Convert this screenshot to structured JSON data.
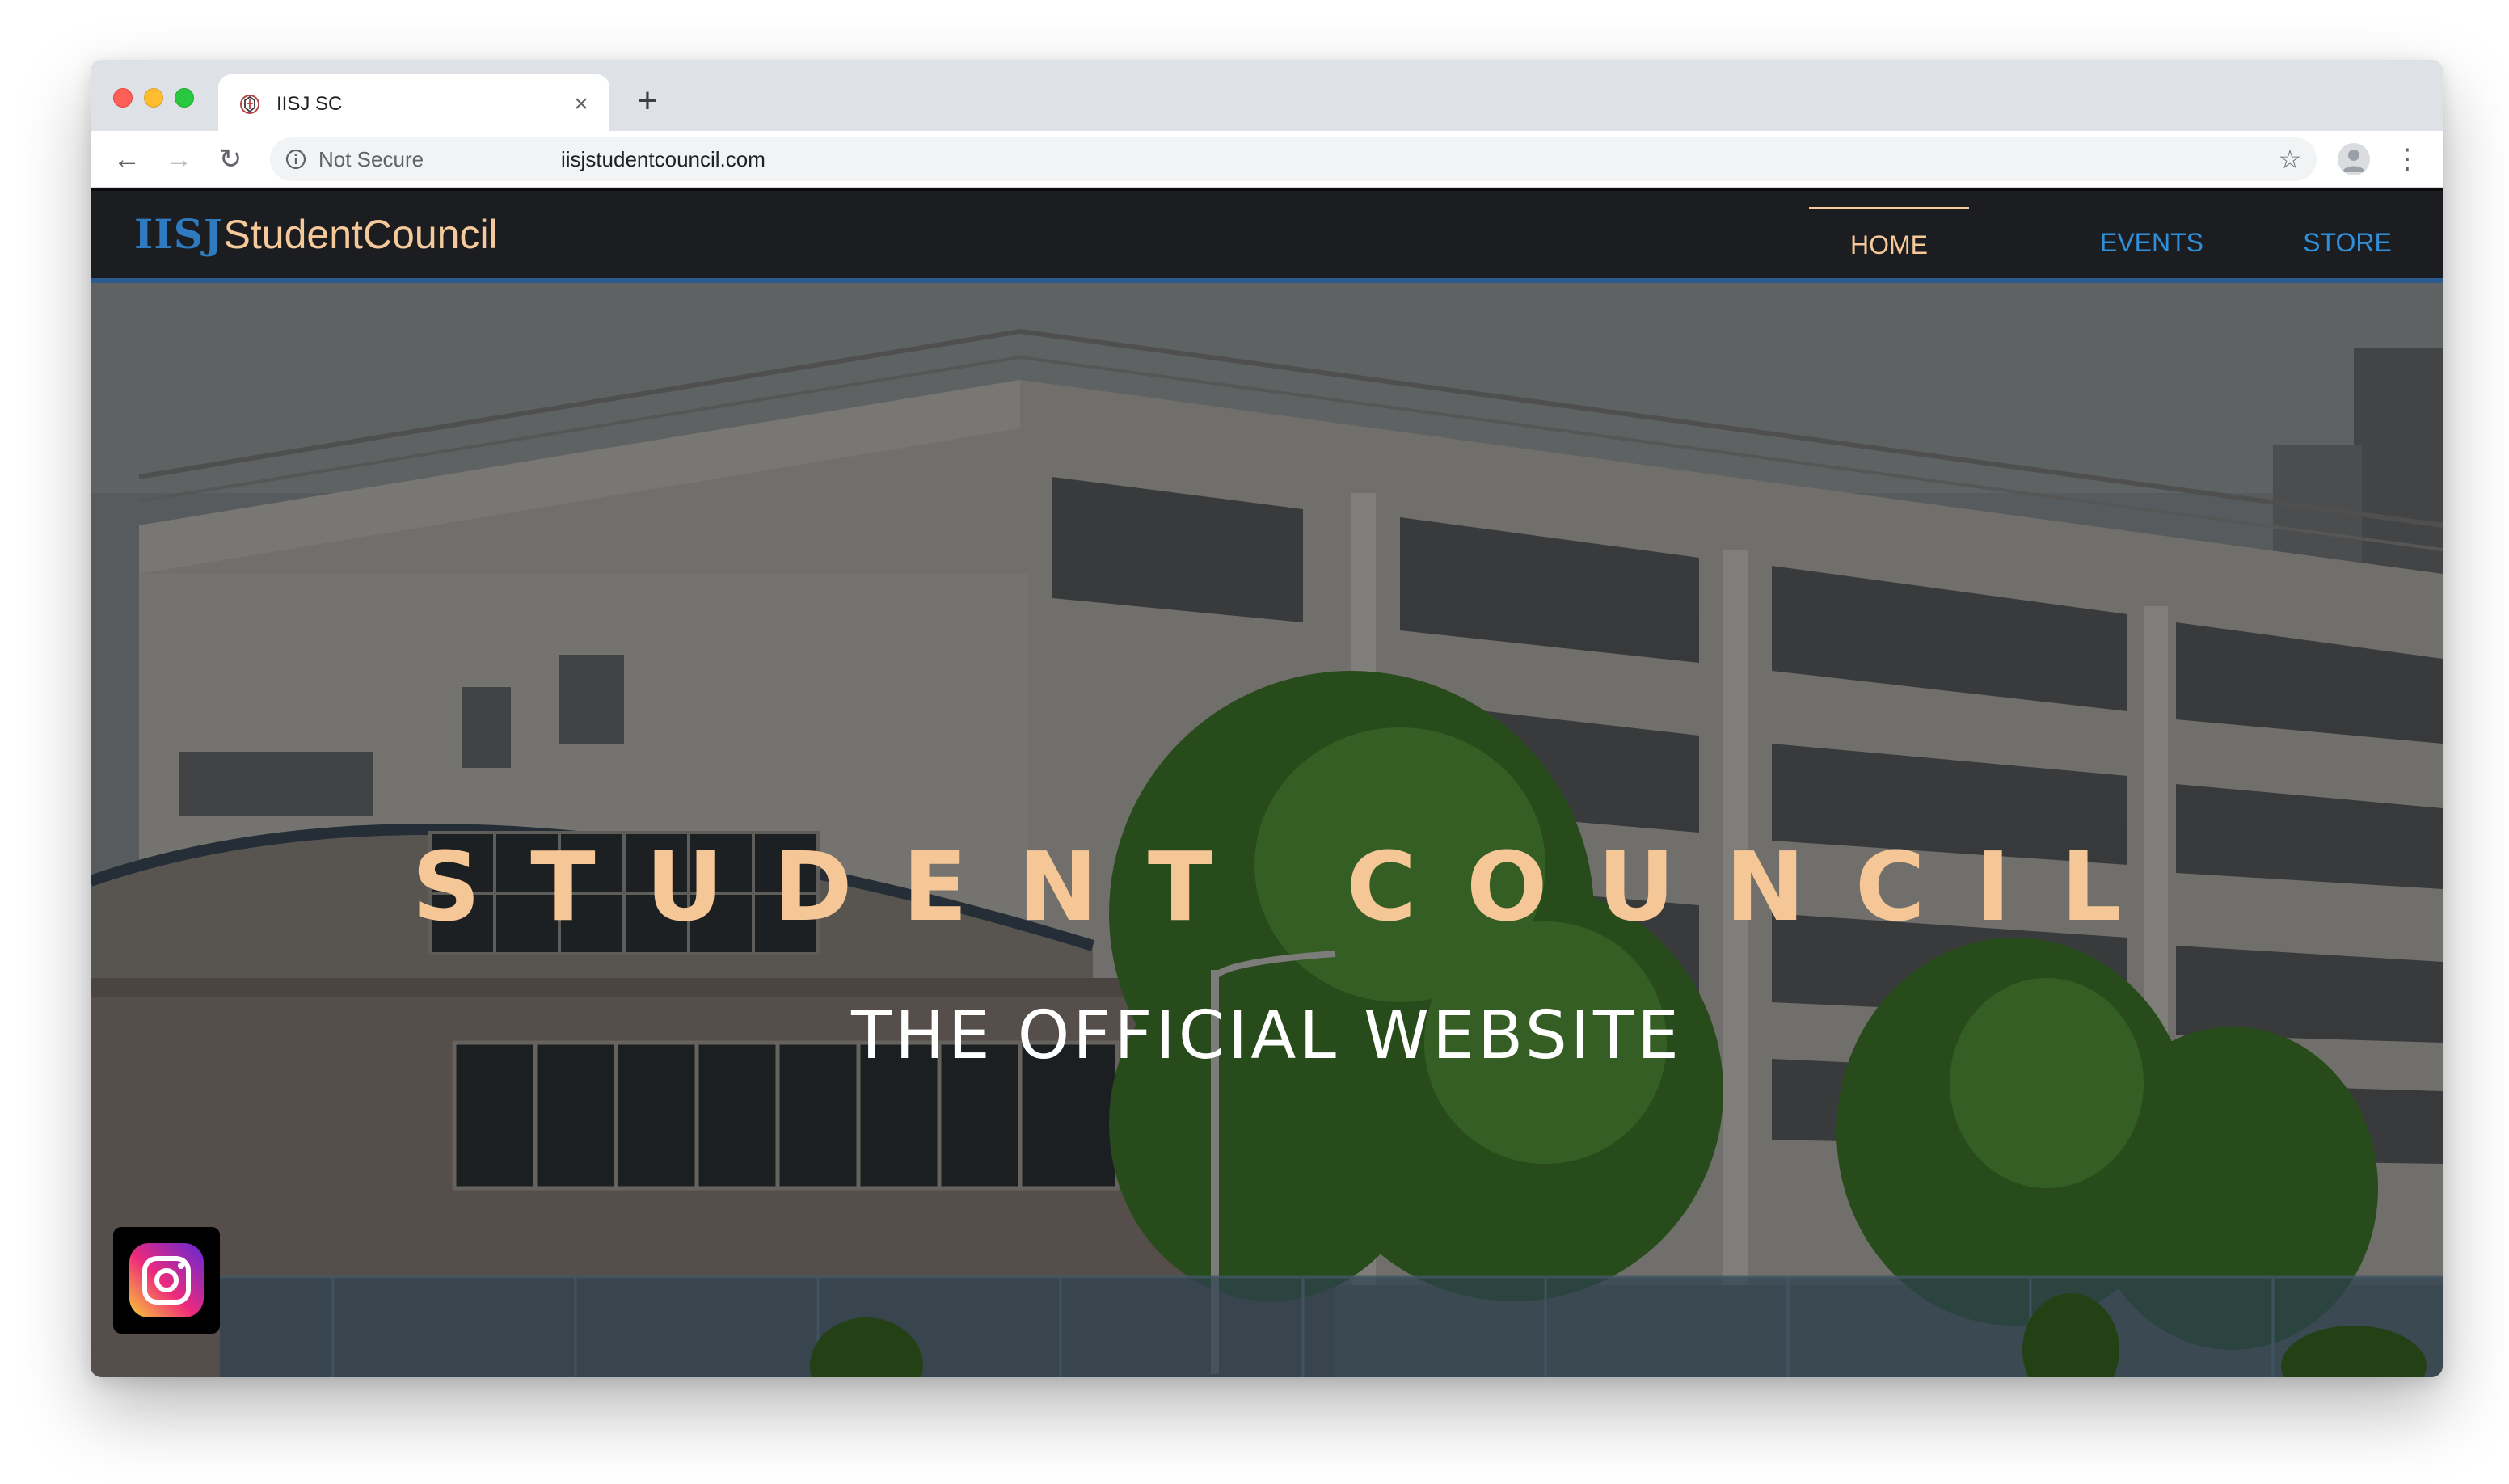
{
  "browser": {
    "tab": {
      "title": "IISJ SC",
      "close_glyph": "×",
      "favicon": "school-crest-icon"
    },
    "new_tab_glyph": "+",
    "toolbar": {
      "back_glyph": "←",
      "forward_glyph": "→",
      "reload_glyph": "↻",
      "security_label": "Not Secure",
      "url": "iisjstudentcouncil.com",
      "bookmark_glyph": "☆",
      "menu_glyph": "⋮"
    }
  },
  "site": {
    "brand": {
      "prefix": "IISJ",
      "name": "StudentCouncil"
    },
    "nav": [
      {
        "label": "HOME",
        "active": true
      },
      {
        "label": "EVENTS",
        "active": false
      },
      {
        "label": "STORE",
        "active": false
      }
    ],
    "hero": {
      "title": "STUDENT COUNCIL",
      "subtitle": "THE OFFICIAL WEBSITE",
      "background": "school-building-photo"
    },
    "social": {
      "instagram": "instagram-icon"
    }
  },
  "colors": {
    "brand_blue": "#2f7bc0",
    "accent_peach": "#f6c796",
    "nav_bg": "#1c1d20",
    "nav_link": "#2f8fd8"
  }
}
